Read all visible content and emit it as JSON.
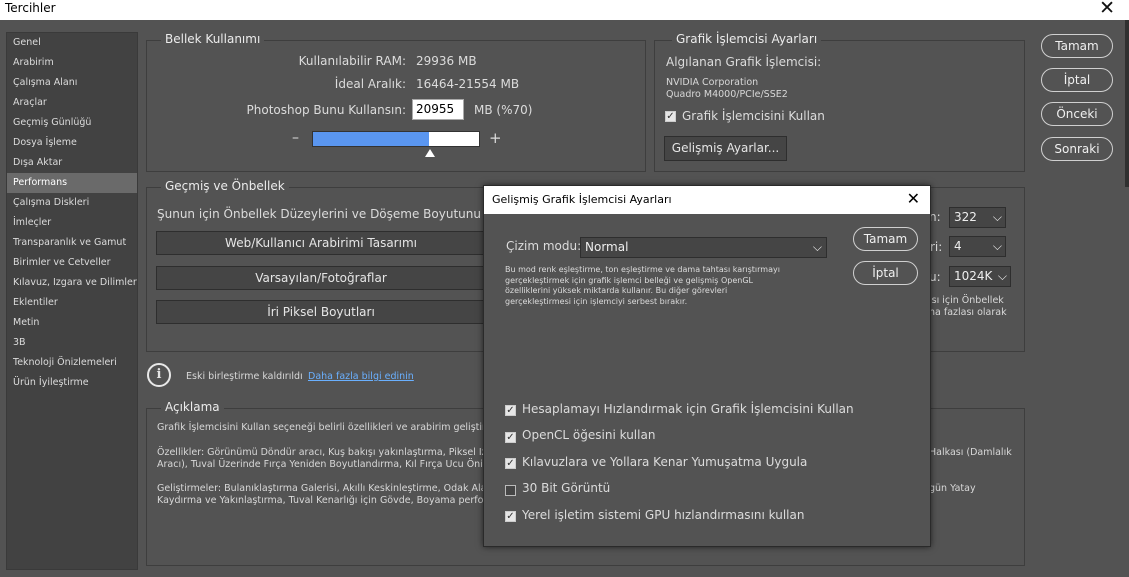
{
  "window": {
    "title": "Tercihler",
    "close_glyph": "✕"
  },
  "sidebar": {
    "items": [
      {
        "label": "Genel"
      },
      {
        "label": "Arabirim"
      },
      {
        "label": "Çalışma Alanı"
      },
      {
        "label": "Araçlar"
      },
      {
        "label": "Geçmiş Günlüğü"
      },
      {
        "label": "Dosya İşleme"
      },
      {
        "label": "Dışa Aktar"
      },
      {
        "label": "Performans"
      },
      {
        "label": "Çalışma Diskleri"
      },
      {
        "label": "İmleçler"
      },
      {
        "label": "Transparanlık ve Gamut"
      },
      {
        "label": "Birimler ve Cetveller"
      },
      {
        "label": "Kılavuz, Izgara ve Dilimler"
      },
      {
        "label": "Eklentiler"
      },
      {
        "label": "Metin"
      },
      {
        "label": "3B"
      },
      {
        "label": "Teknoloji Önizlemeleri"
      },
      {
        "label": "Ürün İyileştirme"
      }
    ],
    "selected": "Performans"
  },
  "right_buttons": {
    "ok": "Tamam",
    "cancel": "İptal",
    "prev": "Önceki",
    "next": "Sonraki"
  },
  "memory": {
    "title": "Bellek Kullanımı",
    "available_label": "Kullanılabilir RAM:",
    "available_value": "29936 MB",
    "ideal_label": "İdeal Aralık:",
    "ideal_value": "16464-21554 MB",
    "use_label": "Photoshop Bunu Kullansın:",
    "use_value": "20955",
    "use_suffix": "MB (%70)",
    "minus": "–",
    "plus": "+",
    "slider_fraction": 0.7
  },
  "gpu": {
    "title": "Grafik İşlemcisi Ayarları",
    "detected_label": "Algılanan Grafik İşlemcisi:",
    "vendor": "NVIDIA Corporation",
    "model": "Quadro M4000/PCIe/SSE2",
    "use_gpu_label": "Grafik İşlemcisini Kullan",
    "advanced_button": "Gelişmiş Ayarlar..."
  },
  "history": {
    "title": "Geçmiş ve Önbellek",
    "intro": "Şunun için Önbellek Düzeylerini ve Döşeme Boyutunu iyileş",
    "presets": [
      "Web/Kullanıcı Arabirimi Tasarımı",
      "Varsayılan/Fotoğraflar",
      "İri Piksel Boyutları"
    ],
    "history_states_suffix": "n:",
    "history_states": "322",
    "cache_levels_suffix": "ri:",
    "cache_levels": "4",
    "tile_size_suffix": "u:",
    "tile_size": "1024K",
    "note_line1": "ısı için Önbellek",
    "note_line2": "ha fazlası olarak"
  },
  "legacy": {
    "info_glyph": "i",
    "text": "Eski birleştirme kaldırıldı",
    "link": "Daha fazla bilgi edinin"
  },
  "description": {
    "title": "Açıklama",
    "line1": "Grafik İşlemcisini Kullan seçeneği belirli özellikleri ve arabirim geliştirmele",
    "features_line1": "Özellikler: Görünümü Döndür aracı, Kuş bakışı yakınlaştırma, Piksel Izgar",
    "features_line2": "Aracı), Tuval Üzerinde Fırça Yeniden Boyutlandırma, Kıl Fırça Ucu Önizler",
    "features_right1": "Halkası (Damlalık",
    "improvements_line1": "Geliştirmeler: Bulanıklaştırma Galerisi, Akıllı Keskinleştirme, Odak Alanını S",
    "improvements_line2": "Kaydırma ve Yakınlaştırma, Tuval Kenarlığı için Gövde, Boyama performan",
    "improvements_right1": "gün Yatay"
  },
  "dialog": {
    "title": "Gelişmiş Grafik İşlemcisi Ayarları",
    "close_glyph": "✕",
    "mode_label": "Çizim modu:",
    "mode_value": "Normal",
    "mode_desc": [
      "Bu mod renk eşleştirme, ton eşleştirme ve dama tahtası karıştırmayı",
      "gerçekleştirmek için grafik işlemci belleği ve gelişmiş OpenGL",
      "özelliklerini yüksek miktarda kullanır. Bu diğer görevleri",
      "gerçekleştirmesi için işlemciyi serbest bırakır."
    ],
    "ok": "Tamam",
    "cancel": "İptal",
    "options": [
      {
        "label": "Hesaplamayı Hızlandırmak için Grafik İşlemcisini Kullan",
        "checked": true
      },
      {
        "label": "OpenCL öğesini kullan",
        "checked": true
      },
      {
        "label": "Kılavuzlara ve Yollara Kenar Yumuşatma Uygula",
        "checked": true
      },
      {
        "label": "30 Bit Görüntü",
        "checked": false
      },
      {
        "label": "Yerel işletim sistemi GPU hızlandırmasını kullan",
        "checked": true
      }
    ]
  },
  "glyphs": {
    "check": "✓",
    "chevron": "⌵"
  }
}
